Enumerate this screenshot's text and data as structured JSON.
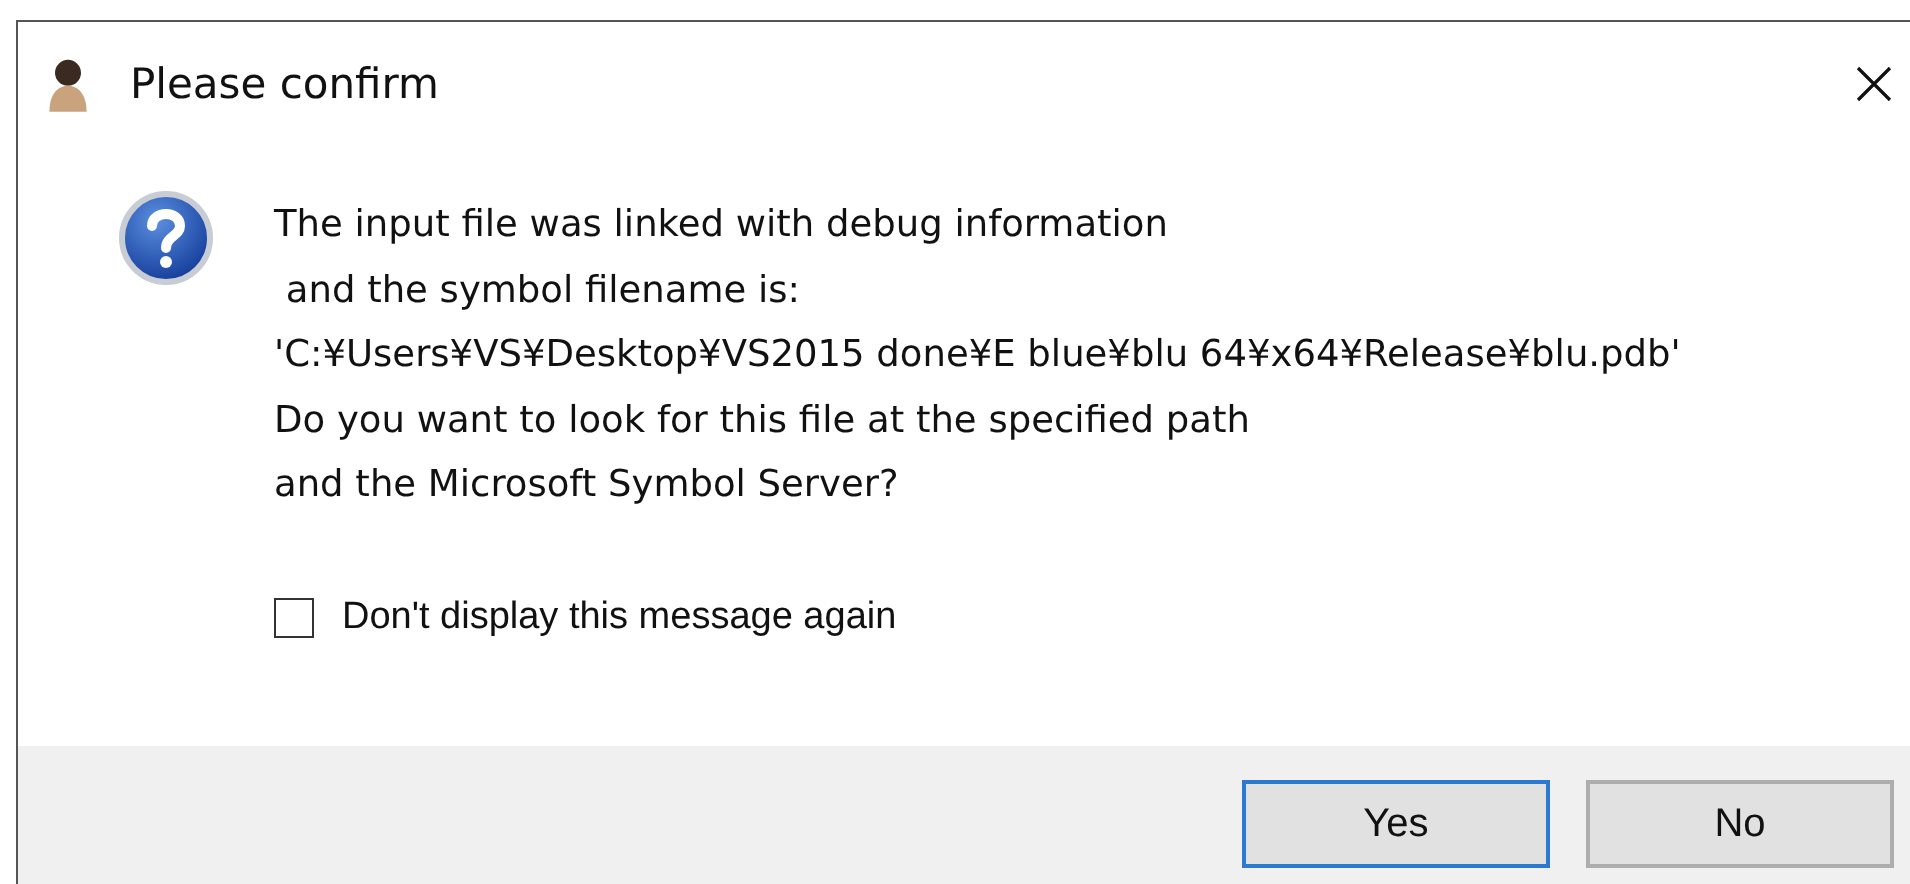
{
  "window": {
    "title": "Please confirm"
  },
  "message": "The input file was linked with debug information\n and the symbol filename is:\n'C:¥Users¥VS¥Desktop¥VS2015 done¥E blue¥blu 64¥x64¥Release¥blu.pdb'\nDo you want to look for this file at the specified path\nand the Microsoft Symbol Server?",
  "checkbox": {
    "label": "Don't display this message again",
    "checked": false
  },
  "buttons": [
    {
      "label": "Yes",
      "default": true
    },
    {
      "label": "No",
      "default": false
    }
  ]
}
